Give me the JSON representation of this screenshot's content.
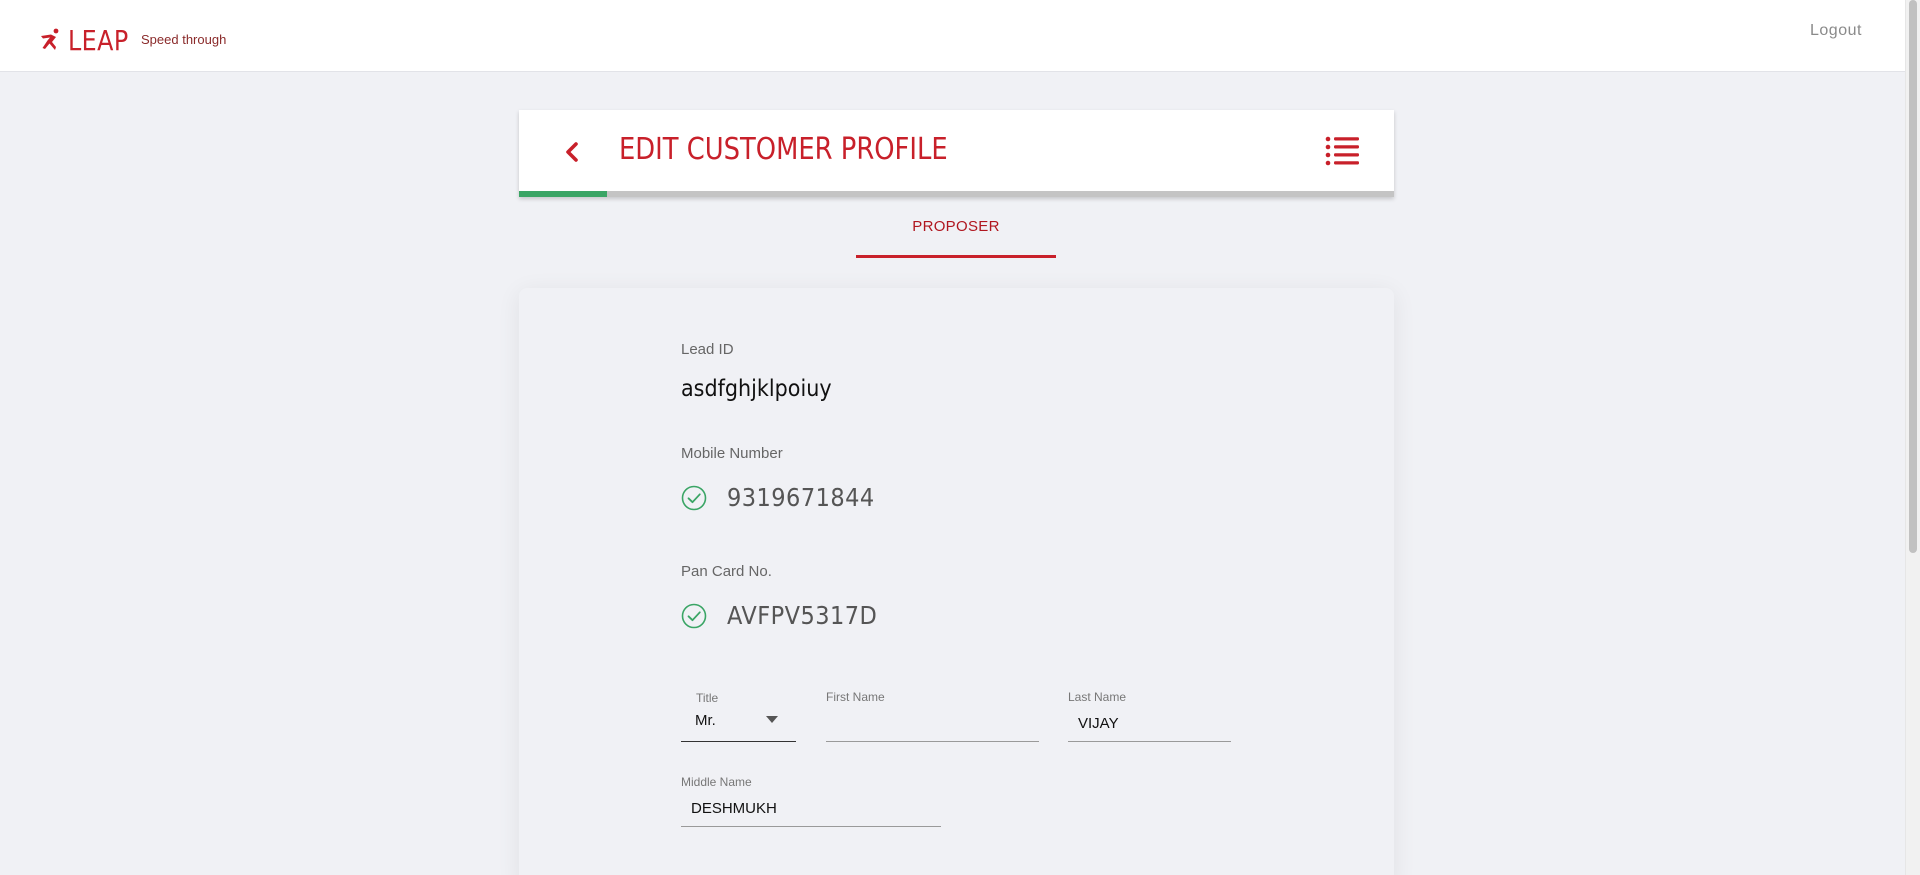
{
  "app": {
    "brand": "LEAP",
    "tagline": "Speed through",
    "logout_label": "Logout"
  },
  "header": {
    "title": "EDIT CUSTOMER PROFILE",
    "progress_fraction": 0.1
  },
  "tabs": [
    {
      "label": "PROPOSER",
      "active": true
    }
  ],
  "form": {
    "lead_id": {
      "label": "Lead ID",
      "value": "asdfghjklpoiuy"
    },
    "mobile": {
      "label": "Mobile Number",
      "value": "9319671844",
      "verified": true
    },
    "pan": {
      "label": "Pan Card No.",
      "value": "AVFPV5317D",
      "verified": true
    },
    "title_field": {
      "label": "Title",
      "value": "Mr."
    },
    "first_name": {
      "label": "First Name",
      "value": ""
    },
    "last_name": {
      "label": "Last Name",
      "value": "VIJAY"
    },
    "middle_name": {
      "label": "Middle Name",
      "value": "DESHMUKH"
    }
  },
  "colors": {
    "brand_red": "#c8202a",
    "progress_green": "#3aa565",
    "verified_green": "#3aa565",
    "background": "#f0f1f5"
  },
  "icons": {
    "logo": "runner-icon",
    "back": "chevron-left-icon",
    "menu": "list-menu-icon",
    "verified": "check-circle-icon",
    "dropdown": "caret-down-icon"
  }
}
